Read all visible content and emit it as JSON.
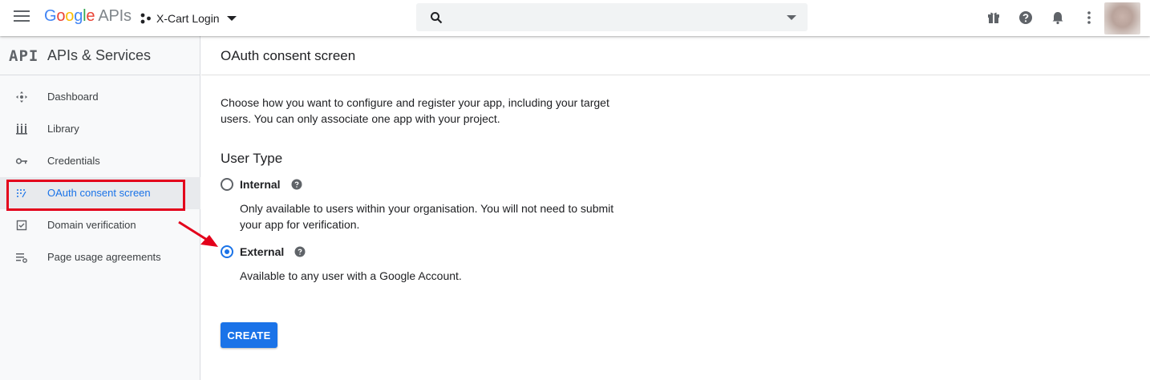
{
  "topbar": {
    "logo_google": [
      "G",
      "o",
      "o",
      "g",
      "l",
      "e"
    ],
    "logo_apis": "APIs",
    "project_name": "X-Cart Login",
    "search_placeholder": "",
    "icons": [
      "menu-icon",
      "project-icon",
      "search-icon",
      "dropdown-icon",
      "gift-icon",
      "help-icon",
      "notifications-icon",
      "more-vert-icon"
    ]
  },
  "sidebar": {
    "api_logo": "API",
    "title": "APIs & Services",
    "items": [
      {
        "label": "Dashboard",
        "icon": "dashboard-icon",
        "active": false
      },
      {
        "label": "Library",
        "icon": "library-icon",
        "active": false
      },
      {
        "label": "Credentials",
        "icon": "key-icon",
        "active": false
      },
      {
        "label": "OAuth consent screen",
        "icon": "consent-icon",
        "active": true
      },
      {
        "label": "Domain verification",
        "icon": "checkbox-icon",
        "active": false
      },
      {
        "label": "Page usage agreements",
        "icon": "settings-list-icon",
        "active": false
      }
    ]
  },
  "main": {
    "title": "OAuth consent screen",
    "intro": "Choose how you want to configure and register your app, including your target users. You can only associate one app with your project.",
    "user_type_heading": "User Type",
    "options": [
      {
        "label": "Internal",
        "selected": false,
        "description": "Only available to users within your organisation. You will not need to submit your app for verification."
      },
      {
        "label": "External",
        "selected": true,
        "description": "Available to any user with a Google Account."
      }
    ],
    "create_label": "CREATE"
  },
  "colors": {
    "accent": "#1a73e8",
    "highlight": "#e3001b",
    "sidebar_bg": "#f8f9fa"
  }
}
